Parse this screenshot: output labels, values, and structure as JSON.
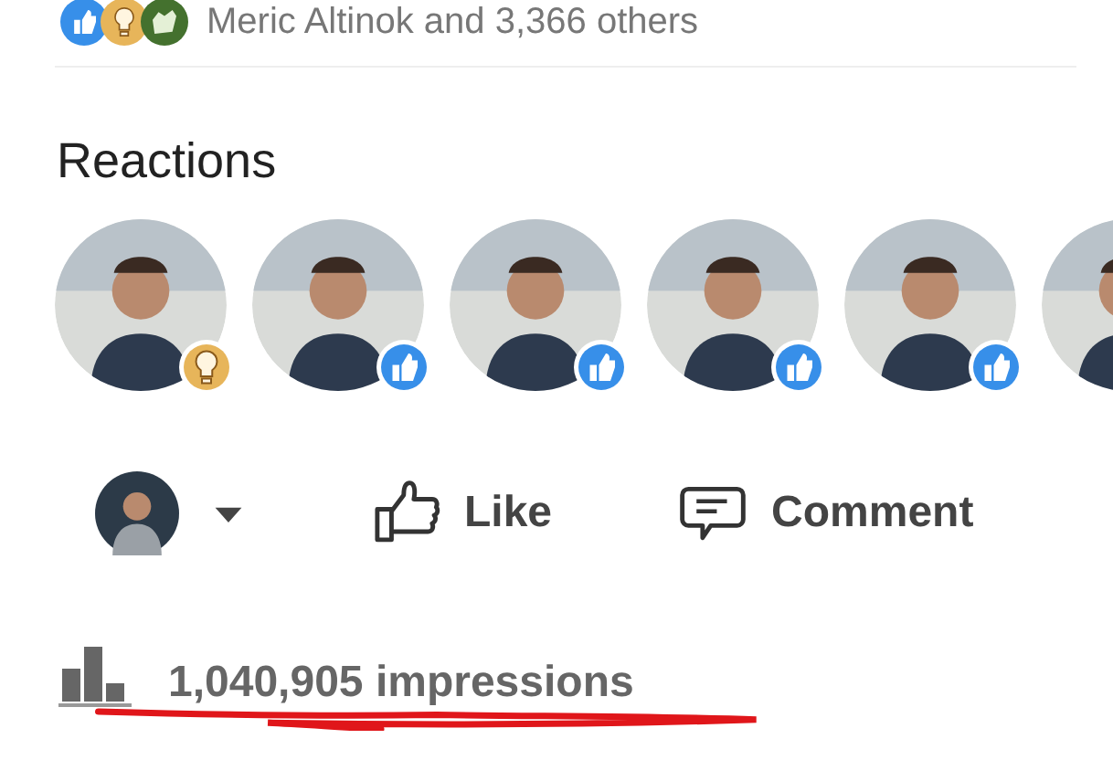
{
  "reaction_summary": {
    "icons": [
      {
        "kind": "like"
      },
      {
        "kind": "insight"
      },
      {
        "kind": "clap"
      }
    ],
    "text": "Meric Altinok and 3,366 others"
  },
  "reactions": {
    "title": "Reactions",
    "people": [
      {
        "kind": "insight"
      },
      {
        "kind": "like"
      },
      {
        "kind": "like"
      },
      {
        "kind": "like"
      },
      {
        "kind": "like"
      },
      {
        "kind": "none"
      }
    ]
  },
  "actions": [
    {
      "kind": "like",
      "label": "Like"
    },
    {
      "kind": "comment",
      "label": "Comment"
    }
  ],
  "impressions": "1,040,905 impressions"
}
